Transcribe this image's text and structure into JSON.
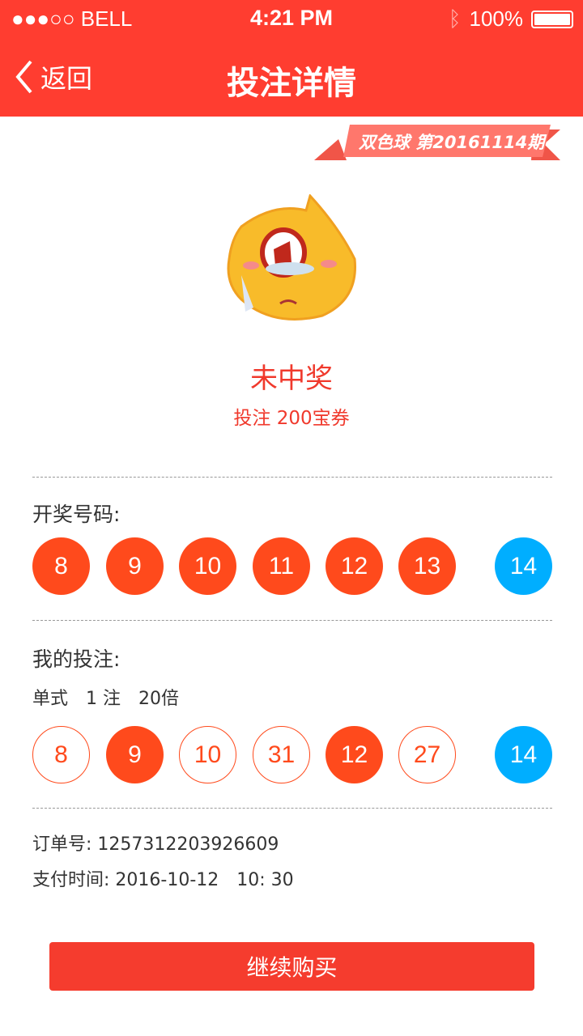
{
  "status": {
    "carrier": "●●●○○ BELL",
    "time": "4:21 PM",
    "battery": "100%"
  },
  "nav": {
    "back": "返回",
    "title": "投注详情"
  },
  "ribbon": "双色球 第20161114期",
  "result": {
    "title": "未中奖",
    "bet": "投注 200宝券"
  },
  "draw": {
    "label": "开奖号码:",
    "red": [
      "8",
      "9",
      "10",
      "11",
      "12",
      "13"
    ],
    "blue": "14"
  },
  "mybet": {
    "label": "我的投注:",
    "detail": "单式　1 注　20倍",
    "balls": [
      {
        "n": "8",
        "hit": false
      },
      {
        "n": "9",
        "hit": true
      },
      {
        "n": "10",
        "hit": false
      },
      {
        "n": "31",
        "hit": false
      },
      {
        "n": "12",
        "hit": true
      },
      {
        "n": "27",
        "hit": false
      }
    ],
    "blue": "14"
  },
  "order": {
    "no": "订单号:  1257312203926609",
    "time": "支付时间:  2016-10-12　10: 30"
  },
  "button": "继续购买",
  "colors": {
    "header": "#ff3d30",
    "red": "#ff4a1c",
    "blue": "#00aeff"
  }
}
